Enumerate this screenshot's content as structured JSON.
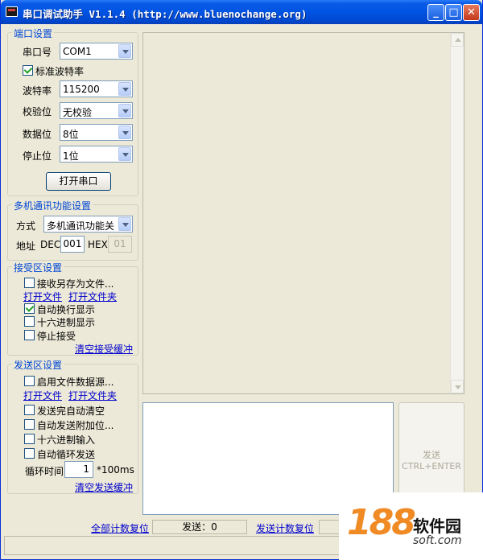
{
  "window": {
    "title": "串口调试助手 V1.1.4 (http://www.bluenochange.org)",
    "minimize": "_",
    "maximize": "□",
    "close": "✕"
  },
  "port_settings": {
    "title": "端口设置",
    "port_label": "串口号",
    "port_value": "COM1",
    "standard_baud_label": "标准波特率",
    "standard_baud_checked": true,
    "baud_label": "波特率",
    "baud_value": "115200",
    "parity_label": "校验位",
    "parity_value": "无校验",
    "databits_label": "数据位",
    "databits_value": "8位",
    "stopbits_label": "停止位",
    "stopbits_value": "1位",
    "open_button": "打开串口"
  },
  "multi_settings": {
    "title": "多机通讯功能设置",
    "mode_label": "方式",
    "mode_value": "多机通讯功能关",
    "address_label": "地址",
    "dec_label": "DEC",
    "dec_value": "001",
    "hex_label": "HEX",
    "hex_value": "01"
  },
  "receive_settings": {
    "title": "接受区设置",
    "save_to_file": "接收另存为文件...",
    "open_file": "打开文件",
    "open_folder": "打开文件夹",
    "auto_newline": "自动换行显示",
    "hex_display": "十六进制显示",
    "stop_receive": "停止接受",
    "clear_buffer": "清空接受缓冲"
  },
  "send_settings": {
    "title": "发送区设置",
    "use_file_source": "启用文件数据源...",
    "open_file": "打开文件",
    "open_folder": "打开文件夹",
    "auto_clear": "发送完自动清空",
    "auto_checksum": "自动发送附加位...",
    "hex_input": "十六进制输入",
    "auto_loop": "自动循环发送",
    "loop_time_label": "循环时间",
    "loop_time_value": "1",
    "loop_time_unit": "*100ms",
    "clear_buffer": "清空发送缓冲"
  },
  "send_button": {
    "line1": "发送",
    "line2": "CTRL+ENTER"
  },
  "counters": {
    "reset_all": "全部计数复位",
    "send_count": "发送：0",
    "reset_send": "发送计数复位"
  },
  "watermark": {
    "logo": "188",
    "name": "软件园",
    "site": "soft.com"
  }
}
